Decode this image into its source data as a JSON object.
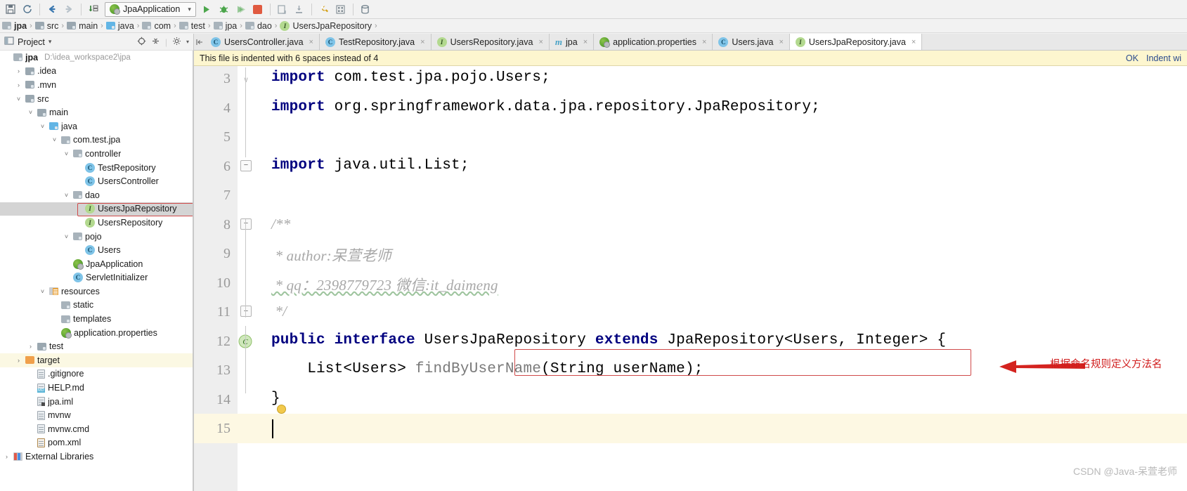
{
  "toolbar": {
    "buttons": [
      {
        "name": "save-all",
        "glyph": "ὋE"
      },
      {
        "name": "sync",
        "glyph": "⟳"
      },
      {
        "name": "back",
        "glyph": "←"
      },
      {
        "name": "forward",
        "glyph": "→"
      },
      {
        "name": "compile",
        "glyph": "↓"
      }
    ],
    "run_config": "JpaApplication",
    "run_label": "Run",
    "debug_label": "Debug",
    "coverage_label": "Run with Coverage",
    "stop_label": "Stop",
    "dropdown_caret": "▾"
  },
  "breadcrumb": {
    "items": [
      {
        "label": "jpa",
        "icon": "module-icon"
      },
      {
        "label": "src",
        "icon": "folder-icon"
      },
      {
        "label": "main",
        "icon": "folder-icon"
      },
      {
        "label": "java",
        "icon": "source-folder-icon"
      },
      {
        "label": "com",
        "icon": "package-icon"
      },
      {
        "label": "test",
        "icon": "package-icon"
      },
      {
        "label": "jpa",
        "icon": "package-icon"
      },
      {
        "label": "dao",
        "icon": "package-icon"
      },
      {
        "label": "UsersJpaRepository",
        "icon": "interface-icon"
      }
    ],
    "separator": "›"
  },
  "project_panel": {
    "title": "Project",
    "dropdown_caret": "▾",
    "tool_icons": [
      "locate-icon",
      "collapse-all-icon",
      "settings-icon"
    ],
    "tree": [
      {
        "label": "jpa",
        "path": "D:\\idea_workspace2\\jpa",
        "depth": 0,
        "chev": "",
        "icon": "module-icon",
        "bold": true
      },
      {
        "label": ".idea",
        "path": "",
        "depth": 1,
        "chev": "›",
        "icon": "folder-icon"
      },
      {
        "label": ".mvn",
        "path": "",
        "depth": 1,
        "chev": "›",
        "icon": "folder-icon"
      },
      {
        "label": "src",
        "path": "",
        "depth": 1,
        "chev": "˅",
        "icon": "folder-icon"
      },
      {
        "label": "main",
        "path": "",
        "depth": 2,
        "chev": "˅",
        "icon": "folder-icon"
      },
      {
        "label": "java",
        "path": "",
        "depth": 3,
        "chev": "˅",
        "icon": "source-folder-icon"
      },
      {
        "label": "com.test.jpa",
        "path": "",
        "depth": 4,
        "chev": "˅",
        "icon": "package-icon"
      },
      {
        "label": "controller",
        "path": "",
        "depth": 5,
        "chev": "˅",
        "icon": "package-icon"
      },
      {
        "label": "TestRepository",
        "path": "",
        "depth": 6,
        "chev": "",
        "icon": "class-icon"
      },
      {
        "label": "UsersController",
        "path": "",
        "depth": 6,
        "chev": "",
        "icon": "class-icon"
      },
      {
        "label": "dao",
        "path": "",
        "depth": 5,
        "chev": "˅",
        "icon": "package-icon"
      },
      {
        "label": "UsersJpaRepository",
        "path": "",
        "depth": 6,
        "chev": "",
        "icon": "interface-icon",
        "selected": true,
        "annotated": true
      },
      {
        "label": "UsersRepository",
        "path": "",
        "depth": 6,
        "chev": "",
        "icon": "interface-icon"
      },
      {
        "label": "pojo",
        "path": "",
        "depth": 5,
        "chev": "˅",
        "icon": "package-icon"
      },
      {
        "label": "Users",
        "path": "",
        "depth": 6,
        "chev": "",
        "icon": "class-icon"
      },
      {
        "label": "JpaApplication",
        "path": "",
        "depth": 5,
        "chev": "",
        "icon": "spring-class-icon"
      },
      {
        "label": "ServletInitializer",
        "path": "",
        "depth": 5,
        "chev": "",
        "icon": "class-icon"
      },
      {
        "label": "resources",
        "path": "",
        "depth": 3,
        "chev": "˅",
        "icon": "resources-folder-icon"
      },
      {
        "label": "static",
        "path": "",
        "depth": 4,
        "chev": "",
        "icon": "package-icon"
      },
      {
        "label": "templates",
        "path": "",
        "depth": 4,
        "chev": "",
        "icon": "package-icon"
      },
      {
        "label": "application.properties",
        "path": "",
        "depth": 4,
        "chev": "",
        "icon": "spring-properties-icon"
      },
      {
        "label": "test",
        "path": "",
        "depth": 2,
        "chev": "›",
        "icon": "folder-icon"
      },
      {
        "label": "target",
        "path": "",
        "depth": 1,
        "chev": "›",
        "icon": "excluded-folder-icon",
        "highlight": true
      },
      {
        "label": ".gitignore",
        "path": "",
        "depth": 2,
        "chev": "",
        "icon": "file-icon"
      },
      {
        "label": "HELP.md",
        "path": "",
        "depth": 2,
        "chev": "",
        "icon": "markdown-file-icon"
      },
      {
        "label": "jpa.iml",
        "path": "",
        "depth": 2,
        "chev": "",
        "icon": "iml-file-icon"
      },
      {
        "label": "mvnw",
        "path": "",
        "depth": 2,
        "chev": "",
        "icon": "file-icon"
      },
      {
        "label": "mvnw.cmd",
        "path": "",
        "depth": 2,
        "chev": "",
        "icon": "file-icon"
      },
      {
        "label": "pom.xml",
        "path": "",
        "depth": 2,
        "chev": "",
        "icon": "xml-file-icon"
      },
      {
        "label": "External Libraries",
        "path": "",
        "depth": 0,
        "chev": "›",
        "icon": "external-libraries-icon"
      }
    ]
  },
  "editor_tabs": {
    "pin_icon": "pin-tabs-icon",
    "close_glyph": "×",
    "tabs": [
      {
        "label": "UsersController.java",
        "icon": "class-icon",
        "active": false
      },
      {
        "label": "TestRepository.java",
        "icon": "class-icon",
        "active": false
      },
      {
        "label": "UsersRepository.java",
        "icon": "interface-icon",
        "active": false
      },
      {
        "label": "jpa",
        "icon": "maven-icon",
        "active": false
      },
      {
        "label": "application.properties",
        "icon": "spring-properties-icon",
        "active": false
      },
      {
        "label": "Users.java",
        "icon": "class-icon",
        "active": false
      },
      {
        "label": "UsersJpaRepository.java",
        "icon": "interface-icon",
        "active": true
      }
    ]
  },
  "banner": {
    "message": "This file is indented with 6 spaces instead of 4",
    "ok_label": "OK",
    "action_label": "Indent wi"
  },
  "editor": {
    "lines": [
      {
        "num": "3",
        "segments": [
          {
            "t": "import ",
            "c": "kw"
          },
          {
            "t": "com.test.jpa.pojo.Users;",
            "c": ""
          }
        ],
        "fold": "open",
        "clipped": true
      },
      {
        "num": "4",
        "segments": [
          {
            "t": "import ",
            "c": "kw"
          },
          {
            "t": "org.springframework.data.jpa.repository.JpaRepository;",
            "c": ""
          }
        ]
      },
      {
        "num": "5",
        "segments": []
      },
      {
        "num": "6",
        "segments": [
          {
            "t": "import ",
            "c": "kw"
          },
          {
            "t": "java.util.List;",
            "c": ""
          }
        ],
        "fold": "minus"
      },
      {
        "num": "7",
        "segments": []
      },
      {
        "num": "8",
        "segments": [
          {
            "t": "/**",
            "c": "cmt"
          }
        ],
        "fold": "minus"
      },
      {
        "num": "9",
        "segments": [
          {
            "t": " * author:呆萱老师",
            "c": "cmt"
          }
        ]
      },
      {
        "num": "10",
        "segments": [
          {
            "t": " * qq：2398779723 微信:it_daimeng",
            "c": "cmt"
          }
        ]
      },
      {
        "num": "11",
        "segments": [
          {
            "t": " */",
            "c": "cmt"
          }
        ],
        "fold": "minus"
      },
      {
        "num": "12",
        "segments": [
          {
            "t": "public interface ",
            "c": "kw"
          },
          {
            "t": "UsersJpaRepository ",
            "c": ""
          },
          {
            "t": "extends ",
            "c": "kw"
          },
          {
            "t": "JpaRepository<Users, Integer> {",
            "c": ""
          }
        ],
        "gutter_icon": "spring-bean-icon"
      },
      {
        "num": "13",
        "segments": [
          {
            "t": "    List<Users> ",
            "c": ""
          },
          {
            "t": "findByUserName",
            "c": "meth"
          },
          {
            "t": "(String userName);",
            "c": ""
          }
        ],
        "annotated": true
      },
      {
        "num": "14",
        "segments": [
          {
            "t": "}",
            "c": ""
          }
        ],
        "bulb": true
      },
      {
        "num": "15",
        "segments": [],
        "current": true,
        "caret": true
      }
    ]
  },
  "annotation": {
    "text": "根据命名规则定义方法名",
    "arrow": "left-arrow",
    "color": "#d01a1a"
  },
  "watermark": "CSDN @Java-呆萱老师",
  "colors": {
    "accent_keyword": "#00007f",
    "comment": "#a8a8a8",
    "annotation_red": "#d01a1a",
    "banner_bg": "#fdf6cf",
    "selection": "#d4d4d4",
    "highlight_row": "#fbf8e3"
  }
}
